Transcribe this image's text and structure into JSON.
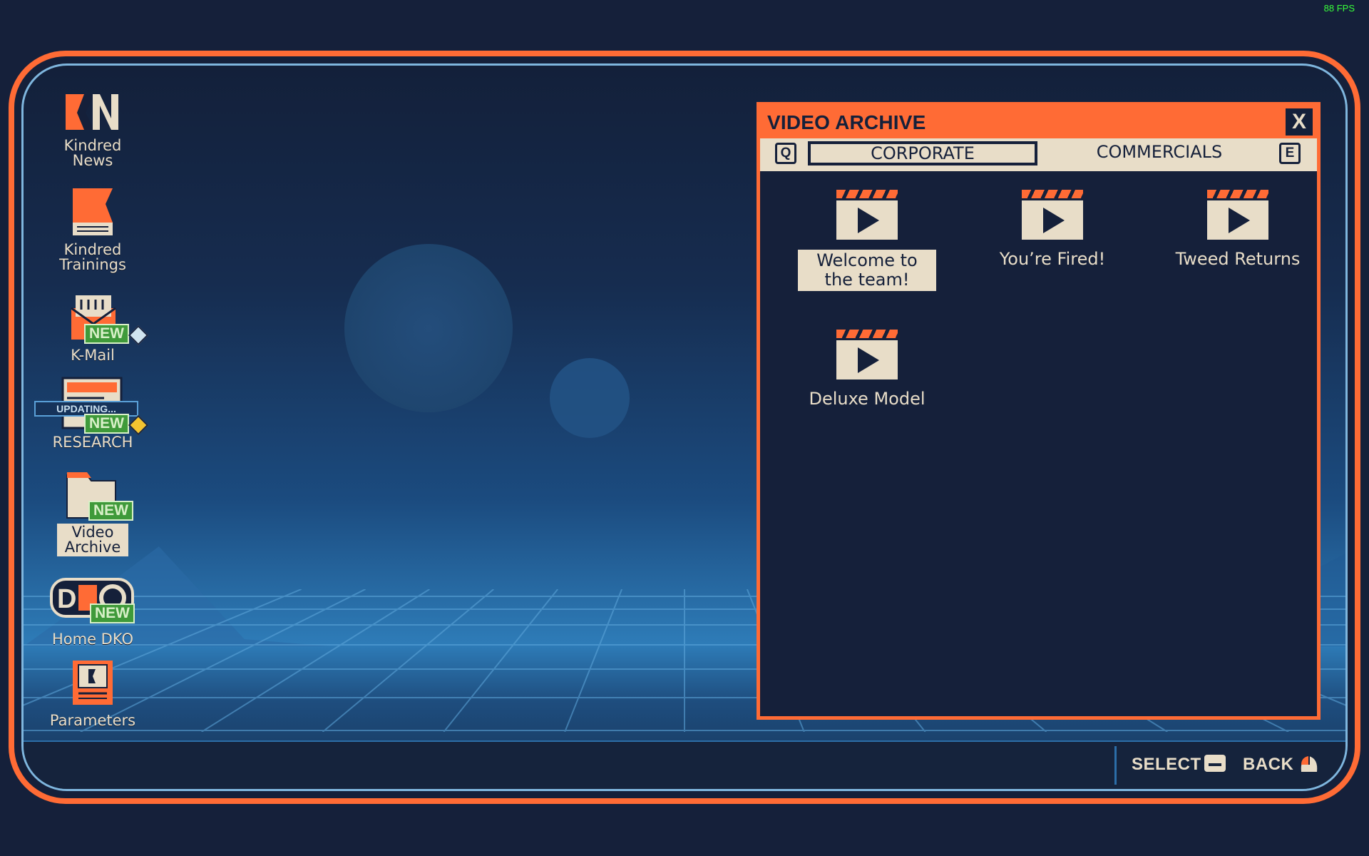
{
  "fps": "88 FPS",
  "desktop": {
    "icons": [
      {
        "label": "Kindred News",
        "new": false
      },
      {
        "label": "Kindred Trainings",
        "new": false
      },
      {
        "label": "K-Mail",
        "new": true,
        "badge": "NEW",
        "diamond_color": "#d0e4f0"
      },
      {
        "label": "RESEARCH",
        "new": true,
        "badge": "NEW",
        "diamond_color": "#f4c430",
        "status": "UPDATING..."
      },
      {
        "label": "Video Archive",
        "new": true,
        "badge": "NEW",
        "selected": true
      },
      {
        "label": "Home DKO",
        "new": true,
        "badge": "NEW"
      },
      {
        "label": "Parameters",
        "new": false
      }
    ]
  },
  "window": {
    "title": "VIDEO ARCHIVE",
    "close_label": "X",
    "tabs": {
      "prev_key": "Q",
      "next_key": "E",
      "items": [
        {
          "label": "CORPORATE",
          "active": true
        },
        {
          "label": "COMMERCIALS",
          "active": false
        }
      ]
    },
    "videos": [
      {
        "title": "Welcome to the team!",
        "selected": true
      },
      {
        "title": "You’re Fired!",
        "selected": false
      },
      {
        "title": "Tweed Returns",
        "selected": false
      },
      {
        "title": "Deluxe Model",
        "selected": false
      }
    ]
  },
  "taskbar": {
    "select_label": "SELECT",
    "back_label": "BACK"
  },
  "colors": {
    "accent": "#ff6b35",
    "cream": "#e8ddc8",
    "navy": "#15203a",
    "new_badge": "#3f9a3a"
  }
}
